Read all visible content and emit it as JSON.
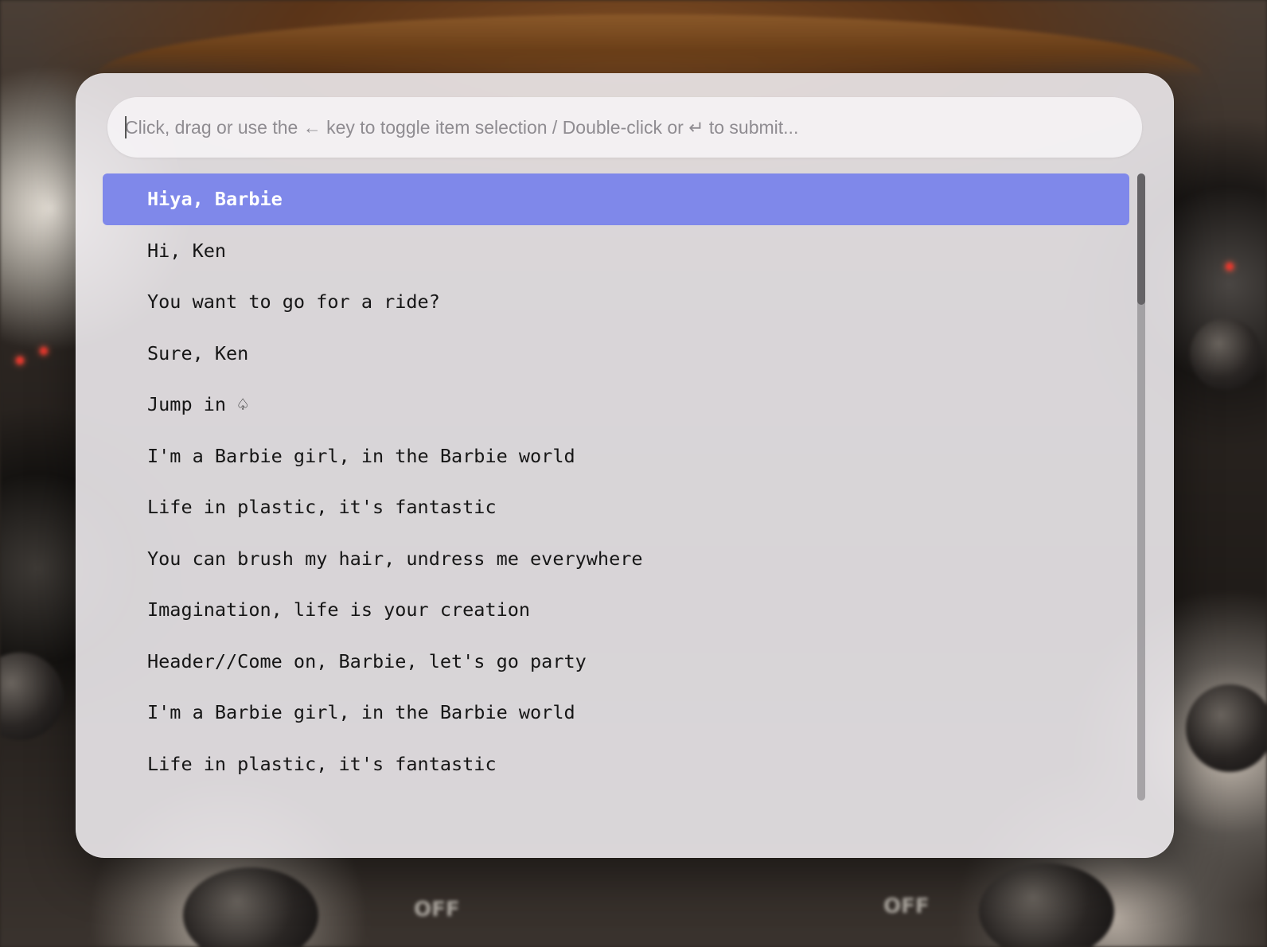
{
  "search": {
    "placeholder": "Click, drag or use the ← key to toggle item selection / Double-click or ↵ to submit...",
    "value": ""
  },
  "list": {
    "selected_index": 0,
    "items": [
      {
        "label": "Hiya, Barbie"
      },
      {
        "label": "Hi, Ken"
      },
      {
        "label": "You want to go for a ride?"
      },
      {
        "label": "Sure, Ken"
      },
      {
        "label": "Jump in ♤"
      },
      {
        "label": "I'm a Barbie girl, in the Barbie world"
      },
      {
        "label": "Life in plastic, it's fantastic"
      },
      {
        "label": "You can brush my hair, undress me everywhere"
      },
      {
        "label": "Imagination, life is your creation"
      },
      {
        "label": "Header//Come on, Barbie, let's go party"
      },
      {
        "label": "I'm a Barbie girl, in the Barbie world"
      },
      {
        "label": "Life in plastic, it's fantastic"
      }
    ]
  },
  "scrollbar": {
    "visible_fraction": 0.21,
    "position_fraction": 0.0
  },
  "background": {
    "off_label_1": "OFF",
    "off_label_2": "OFF"
  },
  "colors": {
    "selection": "#7f88ea",
    "panel": "#ece9ec"
  }
}
